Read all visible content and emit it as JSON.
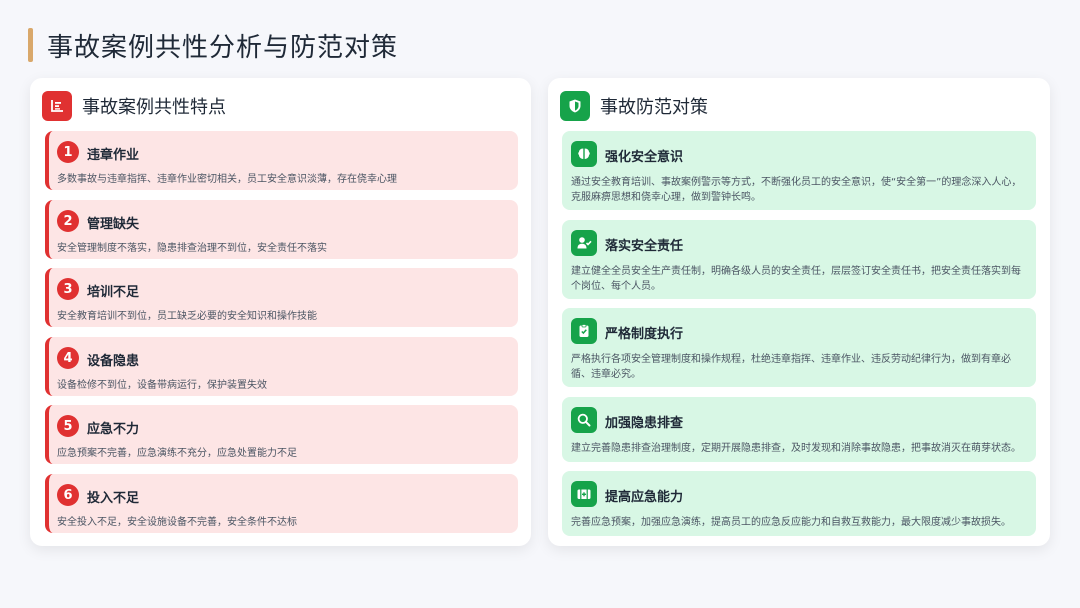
{
  "page": {
    "title": "事故案例共性分析与防范对策"
  },
  "colors": {
    "accent": "#d9a86b",
    "red": "#e03131",
    "red_bg": "#fde5e5",
    "green": "#16a34a",
    "green_bg": "#d8f7e5"
  },
  "left": {
    "title": "事故案例共性特点",
    "icon": "list-chart-icon",
    "items": [
      {
        "num": "1",
        "title": "违章作业",
        "desc": "多数事故与违章指挥、违章作业密切相关，员工安全意识淡薄，存在侥幸心理"
      },
      {
        "num": "2",
        "title": "管理缺失",
        "desc": "安全管理制度不落实，隐患排查治理不到位，安全责任不落实"
      },
      {
        "num": "3",
        "title": "培训不足",
        "desc": "安全教育培训不到位，员工缺乏必要的安全知识和操作技能"
      },
      {
        "num": "4",
        "title": "设备隐患",
        "desc": "设备检修不到位，设备带病运行，保护装置失效"
      },
      {
        "num": "5",
        "title": "应急不力",
        "desc": "应急预案不完善，应急演练不充分，应急处置能力不足"
      },
      {
        "num": "6",
        "title": "投入不足",
        "desc": "安全投入不足，安全设施设备不完善，安全条件不达标"
      }
    ]
  },
  "right": {
    "title": "事故防范对策",
    "icon": "shield-icon",
    "items": [
      {
        "icon": "brain-icon",
        "title": "强化安全意识",
        "desc": "通过安全教育培训、事故案例警示等方式，不断强化员工的安全意识，使“安全第一”的理念深入人心，克服麻痹思想和侥幸心理，做到警钟长鸣。"
      },
      {
        "icon": "user-check-icon",
        "title": "落实安全责任",
        "desc": "建立健全全员安全生产责任制，明确各级人员的安全责任，层层签订安全责任书，把安全责任落实到每个岗位、每个人员。"
      },
      {
        "icon": "clipboard-check-icon",
        "title": "严格制度执行",
        "desc": "严格执行各项安全管理制度和操作规程，杜绝违章指挥、违章作业、违反劳动纪律行为，做到有章必循、违章必究。"
      },
      {
        "icon": "search-icon",
        "title": "加强隐患排查",
        "desc": "建立完善隐患排查治理制度，定期开展隐患排查，及时发现和消除事故隐患，把事故消灭在萌芽状态。"
      },
      {
        "icon": "first-aid-icon",
        "title": "提高应急能力",
        "desc": "完善应急预案，加强应急演练，提高员工的应急反应能力和自救互救能力，最大限度减少事故损失。"
      }
    ]
  }
}
